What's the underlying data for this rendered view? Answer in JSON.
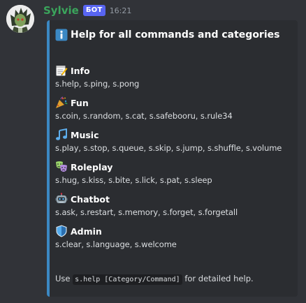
{
  "message": {
    "author": "Sylvie",
    "badge": "БОТ",
    "timestamp": "16:21"
  },
  "embed": {
    "accent_color": "#3b88c3",
    "title_icon": "information-icon",
    "title": "Help for all commands and categories",
    "fields": [
      {
        "icon": "memo-icon",
        "name": "Info",
        "value": "s.help, s.ping, s.pong"
      },
      {
        "icon": "party-popper-icon",
        "name": "Fun",
        "value": "s.coin, s.random, s.cat, s.safebooru, s.rule34"
      },
      {
        "icon": "musical-note-icon",
        "name": "Music",
        "value": "s.play, s.stop, s.queue, s.skip, s.jump, s.shuffle, s.volume"
      },
      {
        "icon": "performing-arts-icon",
        "name": "Roleplay",
        "value": "s.hug, s.kiss, s.bite, s.lick, s.pat, s.sleep"
      },
      {
        "icon": "robot-icon",
        "name": "Chatbot",
        "value": "s.ask, s.restart, s.memory, s.forget, s.forgetall"
      },
      {
        "icon": "shield-icon",
        "name": "Admin",
        "value": "s.clear, s.language, s.welcome"
      }
    ],
    "footer": {
      "prefix": "Use",
      "code": "s.help [Category/Command]",
      "suffix": "for detailed help."
    }
  },
  "colors": {
    "background": "#313338",
    "embed_background": "#2b2d31",
    "username": "#3ba55c",
    "badge": "#5865f2"
  }
}
